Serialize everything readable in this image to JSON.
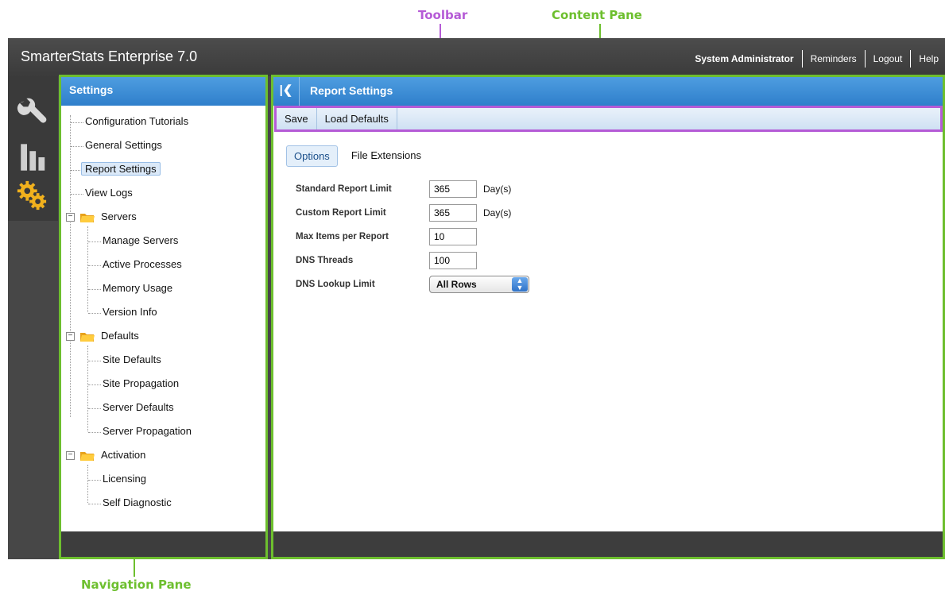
{
  "annotations": {
    "toolbar": "Toolbar",
    "content_pane": "Content Pane",
    "navigation_pane": "Navigation Pane"
  },
  "app": {
    "title": "SmarterStats Enterprise 7.0",
    "user": "System Administrator",
    "links": [
      "Reminders",
      "Logout",
      "Help"
    ]
  },
  "rail": [
    "wrench-icon",
    "stats-icon",
    "gear-icon"
  ],
  "nav": {
    "header": "Settings",
    "items": [
      {
        "label": "Configuration Tutorials"
      },
      {
        "label": "General Settings"
      },
      {
        "label": "Report Settings"
      },
      {
        "label": "View Logs"
      },
      {
        "label": "Servers"
      },
      {
        "label": "Manage Servers"
      },
      {
        "label": "Active Processes"
      },
      {
        "label": "Memory Usage"
      },
      {
        "label": "Version Info"
      },
      {
        "label": "Defaults"
      },
      {
        "label": "Site Defaults"
      },
      {
        "label": "Site Propagation"
      },
      {
        "label": "Server Defaults"
      },
      {
        "label": "Server Propagation"
      },
      {
        "label": "Activation"
      },
      {
        "label": "Licensing"
      },
      {
        "label": "Self Diagnostic"
      }
    ]
  },
  "content": {
    "title": "Report Settings",
    "toolbar": {
      "save": "Save",
      "load_defaults": "Load Defaults"
    },
    "tabs": [
      "Options",
      "File Extensions"
    ],
    "form": {
      "standard_label": "Standard Report Limit",
      "standard_value": "365",
      "custom_label": "Custom Report Limit",
      "custom_value": "365",
      "max_items_label": "Max Items per Report",
      "max_items_value": "10",
      "dns_threads_label": "DNS Threads",
      "dns_threads_value": "100",
      "dns_lookup_label": "DNS Lookup Limit",
      "dns_lookup_value": "All Rows",
      "unit": "Day(s)"
    }
  },
  "colors": {
    "annotation_green": "#6dbf2e",
    "annotation_purple": "#b55bd6",
    "header_blue": "#3a8ad4"
  }
}
